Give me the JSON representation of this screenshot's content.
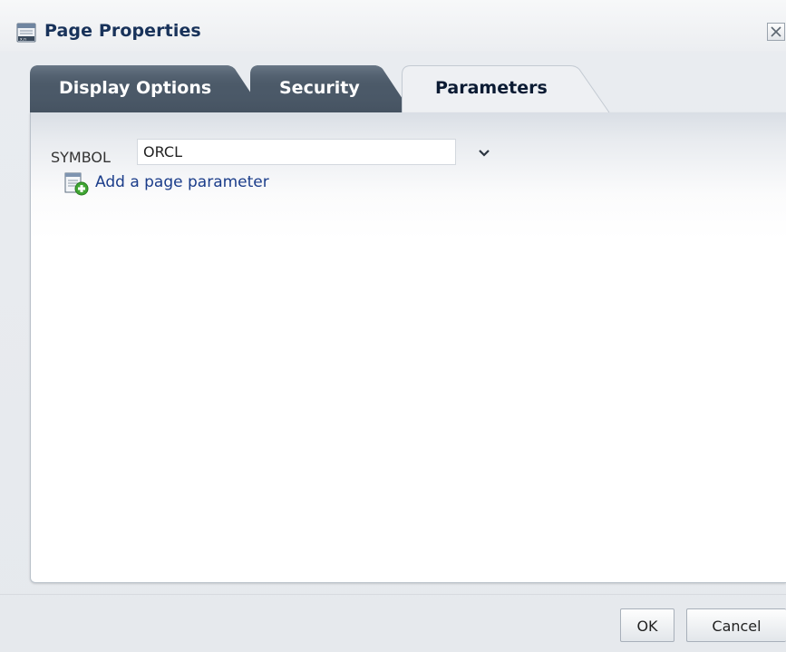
{
  "dialog": {
    "title": "Page Properties",
    "title_icon": "page-properties-icon",
    "close_icon": "close-icon"
  },
  "tabs": [
    {
      "label": "Display Options",
      "selected": false
    },
    {
      "label": "Security",
      "selected": false
    },
    {
      "label": "Parameters",
      "selected": true
    }
  ],
  "parameters": {
    "symbol_label": "SYMBOL",
    "symbol_value": "ORCL",
    "dropdown_icon": "chevron-down-icon",
    "add_parameter_label": "Add a page parameter",
    "add_parameter_icon": "add-parameter-icon"
  },
  "footer": {
    "ok_label": "OK",
    "cancel_label": "Cancel"
  },
  "colors": {
    "title_text": "#18325a",
    "tab_inactive": "#4a5866",
    "tab_active": "#eef0f3",
    "link": "#1b3d8a"
  }
}
